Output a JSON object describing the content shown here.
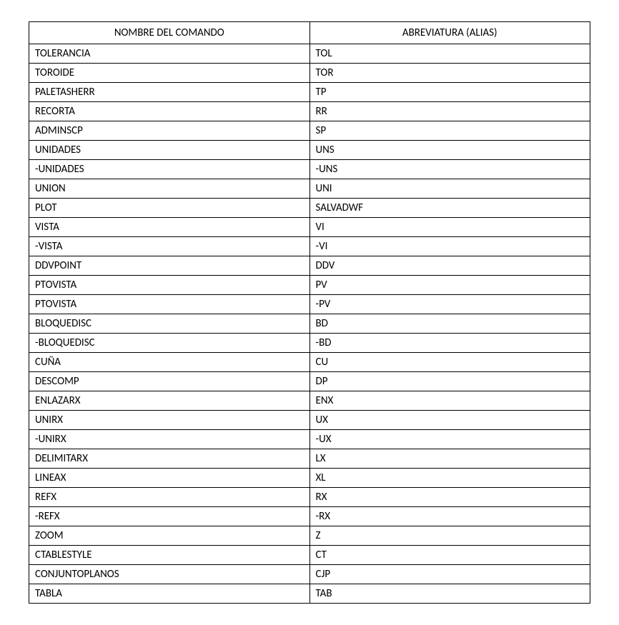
{
  "headers": {
    "name": "NOMBRE DEL COMANDO",
    "alias": "ABREVIATURA (ALIAS)"
  },
  "rows": [
    {
      "name": "TOLERANCIA",
      "alias": "TOL"
    },
    {
      "name": "TOROIDE",
      "alias": "TOR"
    },
    {
      "name": "PALETASHERR",
      "alias": "TP"
    },
    {
      "name": "RECORTA",
      "alias": "RR"
    },
    {
      "name": "ADMINSCP",
      "alias": "SP"
    },
    {
      "name": "UNIDADES",
      "alias": "UNS"
    },
    {
      "name": "-UNIDADES",
      "alias": "-UNS"
    },
    {
      "name": "UNION",
      "alias": "UNI"
    },
    {
      "name": "PLOT",
      "alias": "SALVADWF"
    },
    {
      "name": "VISTA",
      "alias": "VI"
    },
    {
      "name": "-VISTA",
      "alias": "-VI"
    },
    {
      "name": "DDVPOINT",
      "alias": "DDV"
    },
    {
      "name": "PTOVISTA",
      "alias": "PV"
    },
    {
      "name": "PTOVISTA",
      "alias": "-PV"
    },
    {
      "name": "BLOQUEDISC",
      "alias": "BD"
    },
    {
      "name": "-BLOQUEDISC",
      "alias": "-BD"
    },
    {
      "name": "CUÑA",
      "alias": "CU"
    },
    {
      "name": "DESCOMP",
      "alias": "DP"
    },
    {
      "name": "ENLAZARX",
      "alias": "ENX"
    },
    {
      "name": "UNIRX",
      "alias": "UX"
    },
    {
      "name": "-UNIRX",
      "alias": "-UX"
    },
    {
      "name": "DELIMITARX",
      "alias": "LX"
    },
    {
      "name": "LINEAX",
      "alias": "XL"
    },
    {
      "name": "REFX",
      "alias": "RX"
    },
    {
      "name": "-REFX",
      "alias": "-RX"
    },
    {
      "name": "ZOOM",
      "alias": "Z"
    },
    {
      "name": "CTABLESTYLE",
      "alias": "CT"
    },
    {
      "name": "CONJUNTOPLANOS",
      "alias": "CJP"
    },
    {
      "name": "TABLA",
      "alias": "TAB"
    }
  ]
}
